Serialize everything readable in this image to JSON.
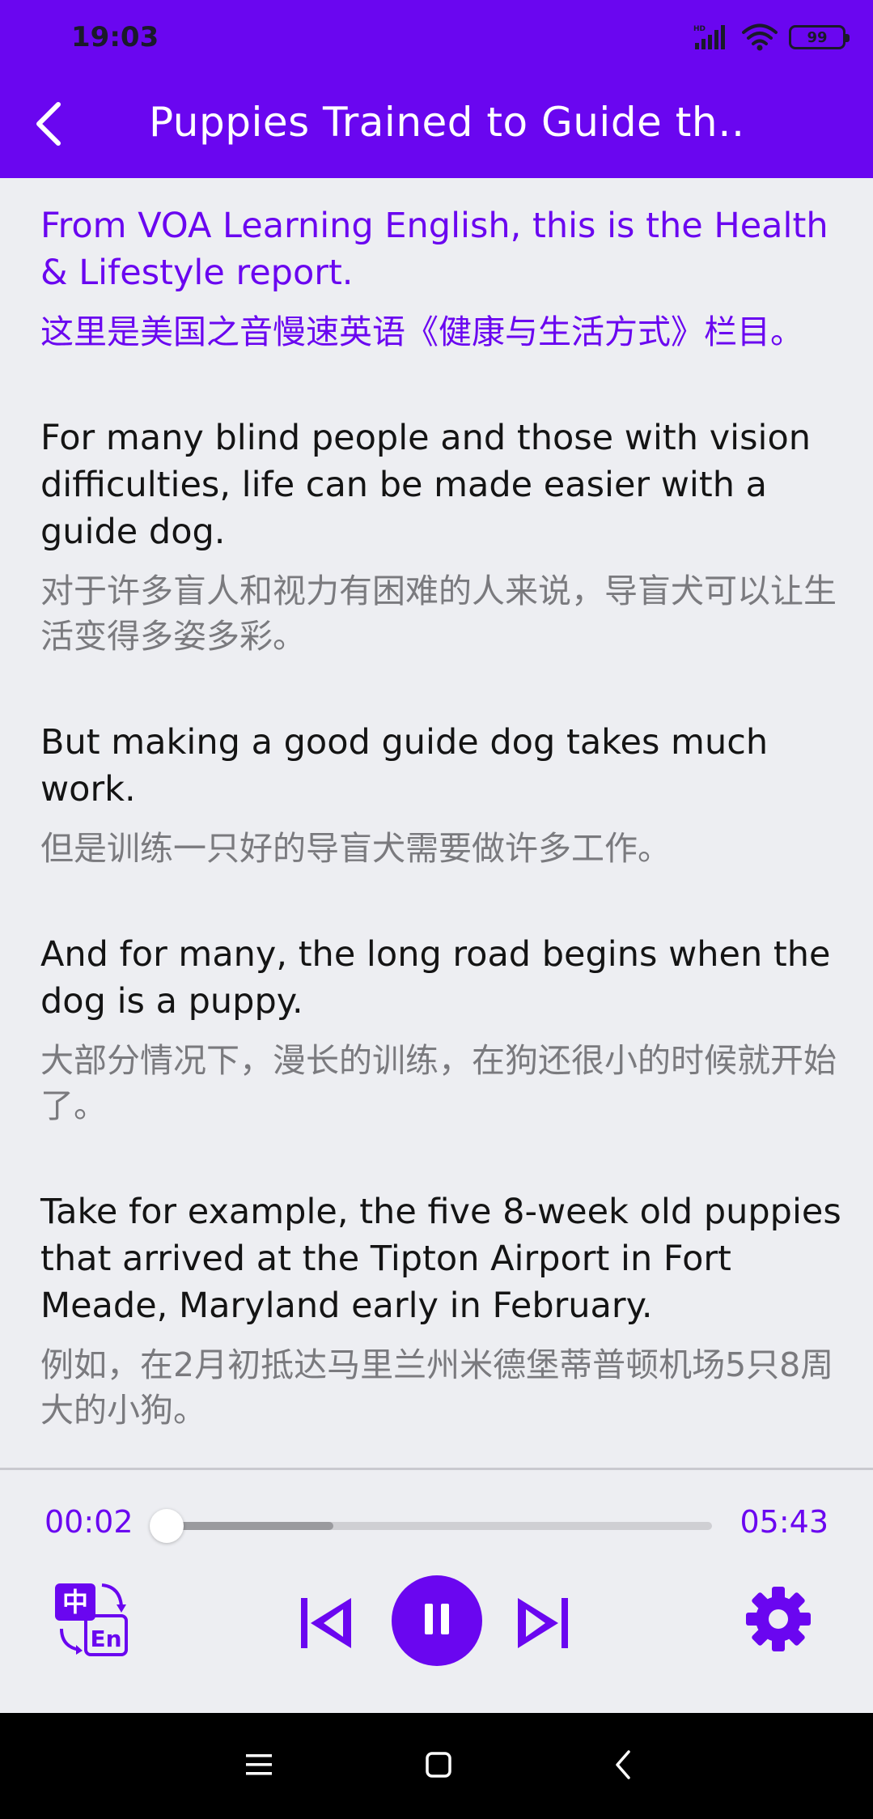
{
  "status_bar": {
    "time": "19:03",
    "battery": "99",
    "icons": [
      "hd-signal-icon",
      "wifi-icon",
      "battery-icon"
    ]
  },
  "app_bar": {
    "title": "Puppies Trained to Guide th…",
    "back_icon": "chevron-left-icon"
  },
  "colors": {
    "accent": "#6a06f0",
    "background": "#edeef2",
    "english_text": "#141414",
    "chinese_text": "#7a7a7e",
    "nav_bar": "#000000"
  },
  "paragraphs": [
    {
      "en": "From VOA Learning English, this is the Health & Lifestyle report.",
      "zh": "这里是美国之音慢速英语《健康与生活方式》栏目。",
      "active": true
    },
    {
      "en": "For many blind people and those with vision difficulties, life can be made easier with a guide dog.",
      "zh": "对于许多盲人和视力有困难的人来说，导盲犬可以让生活变得多姿多彩。",
      "active": false
    },
    {
      "en": "But making a good guide dog takes much work.",
      "zh": "但是训练一只好的导盲犬需要做许多工作。",
      "active": false
    },
    {
      "en": "And for many, the long road begins when the dog is a puppy.",
      "zh": "大部分情况下，漫长的训练，在狗还很小的时候就开始了。",
      "active": false
    },
    {
      "en": "Take for example, the five 8-week old puppies that arrived at the Tipton Airport in Fort Meade, Maryland early in February.",
      "zh": "例如，在2月初抵达马里兰州米德堡蒂普顿机场5只8周大的小狗。",
      "active": false
    }
  ],
  "player": {
    "current_time": "00:02",
    "total_time": "05:43",
    "progress_fraction": 0.006,
    "buffered_fraction": 0.31,
    "is_playing": true,
    "controls": [
      "translate-toggle-icon",
      "skip-previous-icon",
      "pause-icon",
      "skip-next-icon",
      "settings-gear-icon"
    ],
    "lang_toggle": {
      "zh": "中",
      "en": "En"
    }
  },
  "nav_bar": {
    "icons": [
      "menu-icon",
      "home-square-icon",
      "back-triangle-icon"
    ]
  }
}
